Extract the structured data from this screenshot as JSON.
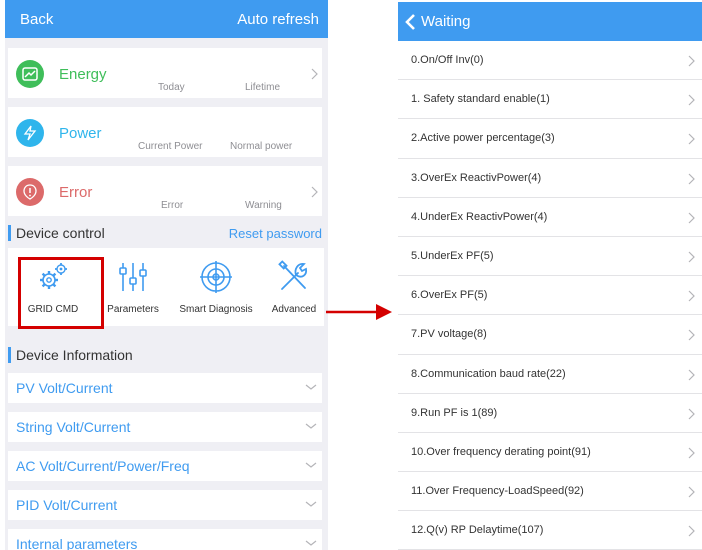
{
  "left": {
    "header": {
      "back": "Back",
      "auto_refresh": "Auto refresh"
    },
    "energy": {
      "title": "Energy",
      "today": "Today",
      "lifetime": "Lifetime"
    },
    "power": {
      "title": "Power",
      "current": "Current Power",
      "normal": "Normal power"
    },
    "error": {
      "title": "Error",
      "error": "Error",
      "warning": "Warning"
    },
    "device_control": {
      "title": "Device control",
      "reset_password": "Reset password",
      "items": [
        {
          "label": "GRID CMD",
          "icon": "gears-icon"
        },
        {
          "label": "Parameters",
          "icon": "sliders-icon"
        },
        {
          "label": "Smart Diagnosis",
          "icon": "target-icon"
        },
        {
          "label": "Advanced",
          "icon": "tools-icon"
        }
      ]
    },
    "device_information": {
      "title": "Device Information",
      "items": [
        "PV Volt/Current",
        "String Volt/Current",
        "AC Volt/Current/Power/Freq",
        "PID Volt/Current",
        "Internal parameters"
      ]
    }
  },
  "right": {
    "title": "Waiting",
    "items": [
      "0.On/Off Inv(0)",
      "1. Safety standard enable(1)",
      "2.Active power percentage(3)",
      "3.OverEx ReactivPower(4)",
      "4.UnderEx ReactivPower(4)",
      "5.UnderEx PF(5)",
      "6.OverEx PF(5)",
      "7.PV voltage(8)",
      "8.Communication baud rate(22)",
      "9.Run PF is 1(89)",
      "10.Over frequency derating point(91)",
      "11.Over Frequency-LoadSpeed(92)",
      "12.Q(v) RP Delaytime(107)"
    ]
  },
  "colors": {
    "accent": "#3f9bf0",
    "energy": "#3fbe5a",
    "power": "#2fb5ec",
    "error": "#dc6a6a",
    "highlight": "#d40000"
  }
}
